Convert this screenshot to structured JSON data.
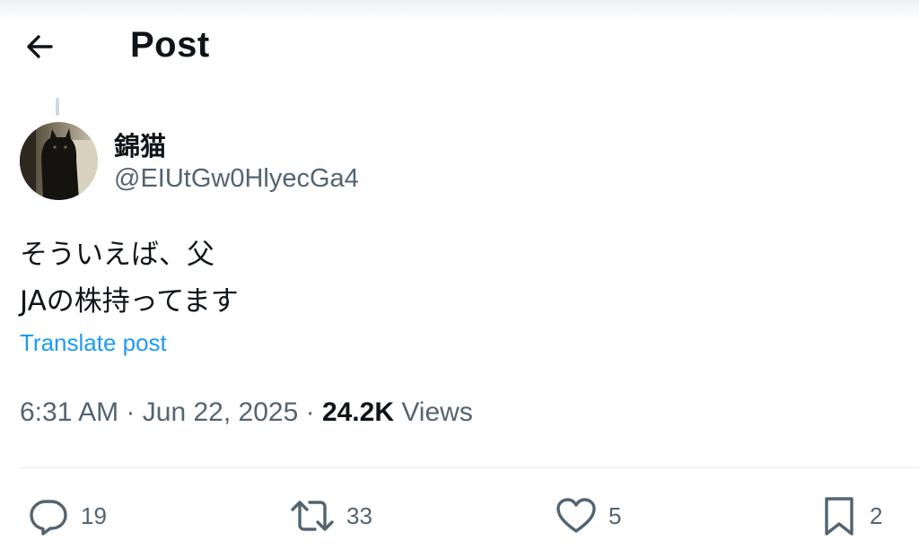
{
  "header": {
    "title": "Post"
  },
  "author": {
    "display_name": "錦猫",
    "handle": "@EIUtGw0HlyecGa4"
  },
  "post": {
    "text_lines": [
      "そういえば、父",
      "JAの株持ってます"
    ],
    "translate_label": "Translate post",
    "time": "6:31 AM",
    "date": "Jun 22, 2025",
    "separator": "·",
    "views_count": "24.2K",
    "views_label": "Views"
  },
  "actions": {
    "reply_count": "19",
    "repost_count": "33",
    "like_count": "5",
    "bookmark_count": "2"
  },
  "icons": {
    "back": "arrow-left-icon",
    "reply": "reply-icon",
    "repost": "repost-icon",
    "like": "heart-icon",
    "bookmark": "bookmark-icon"
  },
  "colors": {
    "link": "#1d9bf0",
    "secondary_text": "#536471",
    "primary_text": "#0f1419"
  }
}
